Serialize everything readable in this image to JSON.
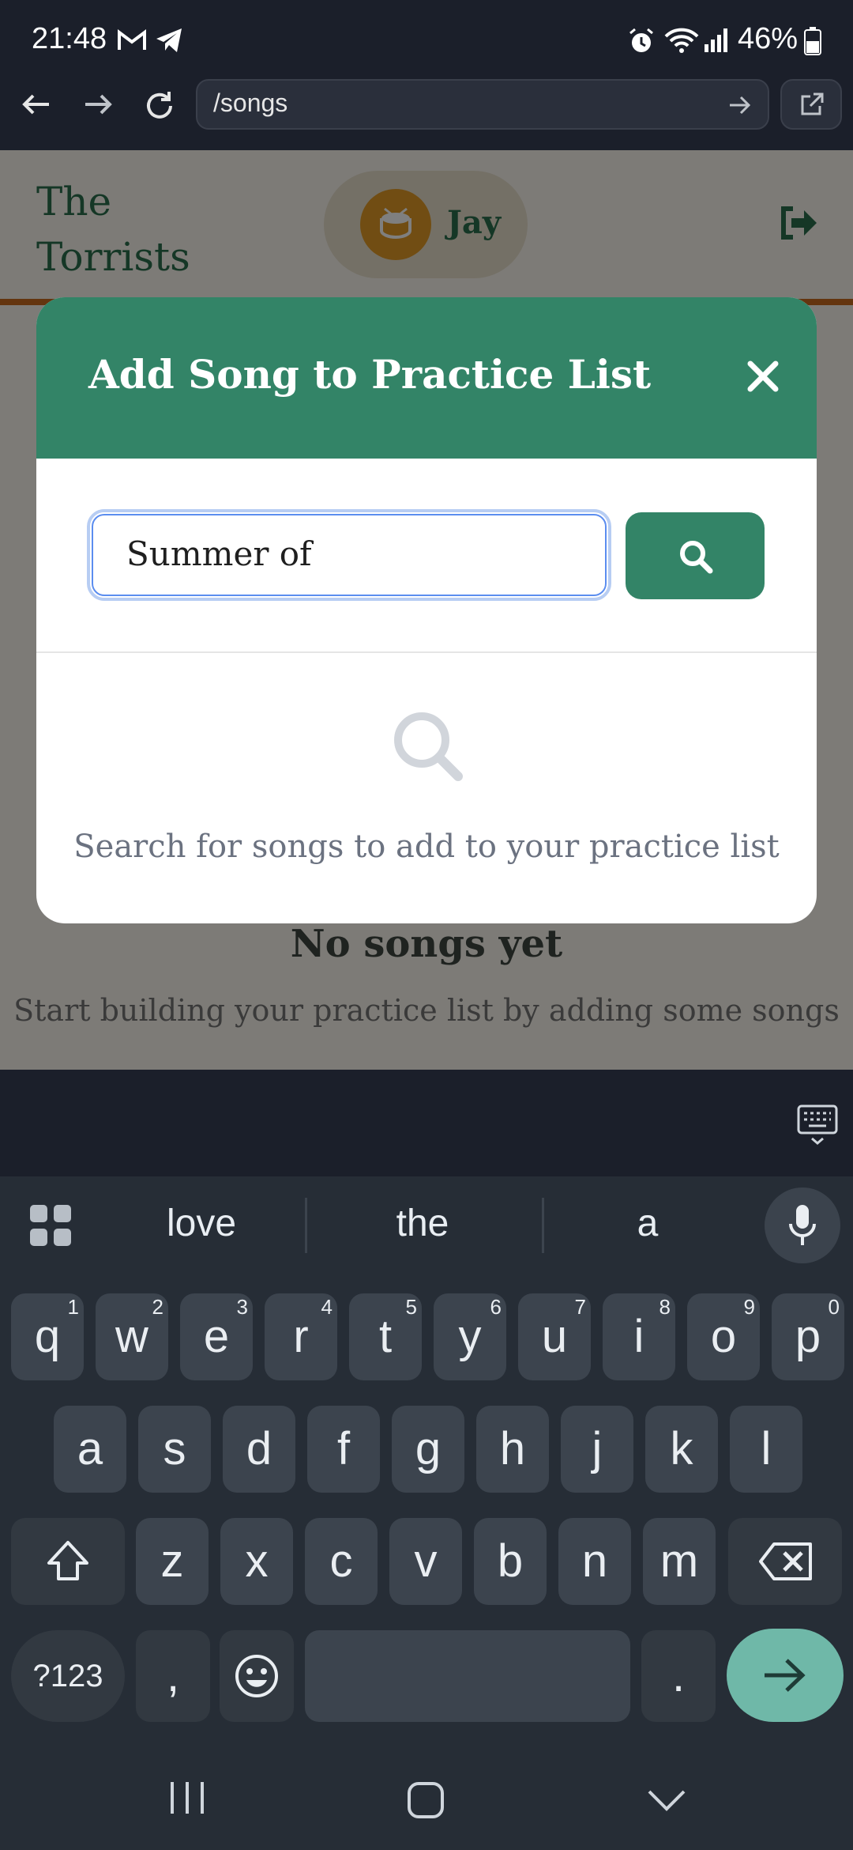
{
  "status_bar": {
    "time": "21:48",
    "battery": "46%",
    "icons": [
      "gmail-icon",
      "telegram-icon",
      "alarm-icon",
      "wifi-icon",
      "signal-icon",
      "battery-icon"
    ]
  },
  "browser": {
    "url": "/songs",
    "buttons": [
      "back-icon",
      "forward-icon",
      "reload-icon",
      "go-icon",
      "open-external-icon"
    ]
  },
  "app_header": {
    "brand_line1": "The",
    "brand_line2": "Torrists",
    "username": "Jay",
    "avatar_icon": "drum-icon"
  },
  "page": {
    "empty_title": "No songs yet",
    "empty_subtitle": "Start building your practice list by adding some songs"
  },
  "modal": {
    "title": "Add Song to Practice List",
    "search_value": "Summer of",
    "hint": "Search for songs to add to your practice list"
  },
  "keyboard": {
    "suggestions": [
      "love",
      "the",
      "a"
    ],
    "row1": [
      {
        "k": "q",
        "h": "1"
      },
      {
        "k": "w",
        "h": "2"
      },
      {
        "k": "e",
        "h": "3"
      },
      {
        "k": "r",
        "h": "4"
      },
      {
        "k": "t",
        "h": "5"
      },
      {
        "k": "y",
        "h": "6"
      },
      {
        "k": "u",
        "h": "7"
      },
      {
        "k": "i",
        "h": "8"
      },
      {
        "k": "o",
        "h": "9"
      },
      {
        "k": "p",
        "h": "0"
      }
    ],
    "row2": [
      "a",
      "s",
      "d",
      "f",
      "g",
      "h",
      "j",
      "k",
      "l"
    ],
    "row3": [
      "z",
      "x",
      "c",
      "v",
      "b",
      "n",
      "m"
    ],
    "symbols_label": "?123",
    "comma_label": ",",
    "period_label": "."
  },
  "colors": {
    "accent_green": "#338467",
    "brand_orange": "#c96a1e",
    "keyboard_bg": "#262d36"
  }
}
